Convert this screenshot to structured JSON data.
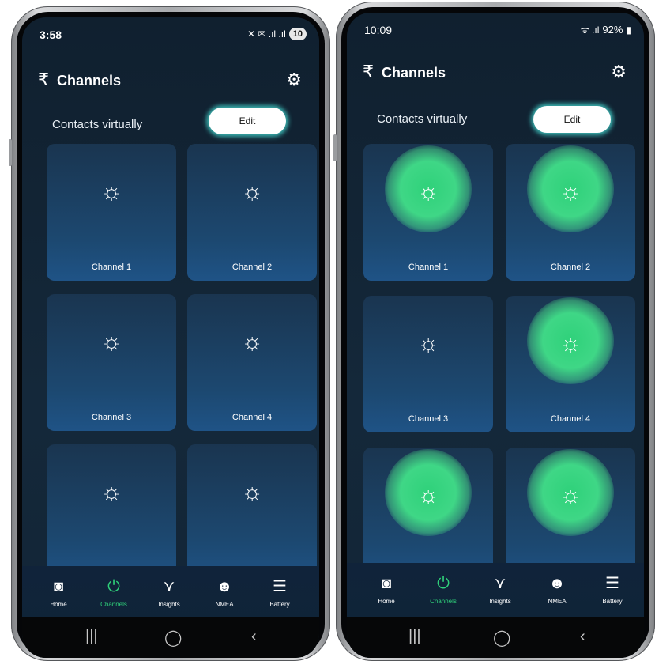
{
  "screens": [
    {
      "status": {
        "time": "3:58",
        "icons": "✕ ✉ .ıl .ıl",
        "badge": "10"
      },
      "header": {
        "title": "Channels"
      },
      "section": {
        "label": "Contacts virtually",
        "edit_label": "Edit"
      },
      "channels": [
        {
          "label": "Channel 1",
          "on": false
        },
        {
          "label": "Channel 2",
          "on": false
        },
        {
          "label": "Channel 3",
          "on": false
        },
        {
          "label": "Channel 4",
          "on": false
        },
        {
          "label": "",
          "on": false
        },
        {
          "label": "",
          "on": false
        }
      ]
    },
    {
      "status": {
        "time": "10:09",
        "icons": "ᯤ .ıl",
        "battery": "92%"
      },
      "header": {
        "title": "Channels"
      },
      "section": {
        "label": "Contacts virtually",
        "edit_label": "Edit"
      },
      "channels": [
        {
          "label": "Channel 1",
          "on": true
        },
        {
          "label": "Channel 2",
          "on": true
        },
        {
          "label": "Channel 3",
          "on": false
        },
        {
          "label": "Channel 4",
          "on": true
        },
        {
          "label": "",
          "on": true
        },
        {
          "label": "",
          "on": true
        }
      ]
    }
  ],
  "nav": {
    "items": [
      {
        "label": "Home",
        "icon": "home-icon"
      },
      {
        "label": "Channels",
        "icon": "power-icon"
      },
      {
        "label": "Insights",
        "icon": "insights-icon"
      },
      {
        "label": "NMEA",
        "icon": "gauge-icon"
      },
      {
        "label": "Battery",
        "icon": "battery-icon"
      }
    ],
    "active": "Channels"
  },
  "colors": {
    "accent": "#2fd17a",
    "edit_glow": "#48e6dc",
    "tile": "#1c4870",
    "background": "#10202f"
  }
}
